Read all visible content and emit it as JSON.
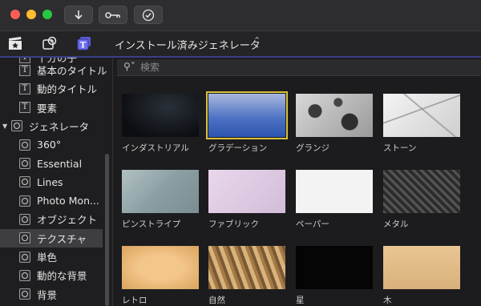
{
  "toolbar": {
    "traffic_colors": [
      "#ff5f57",
      "#febc2e",
      "#28c840"
    ],
    "import_icon": "download-arrow-icon",
    "key_icon": "key-icon",
    "check_icon": "checkmark-circle-icon"
  },
  "browser": {
    "popup_title": "インストール済みジェネレータ",
    "search_placeholder": "検索"
  },
  "sidebar": {
    "partial_item": "十分の子",
    "items": [
      {
        "label": "基本のタイトル",
        "icon": "title-t-icon"
      },
      {
        "label": "動的タイトル",
        "icon": "title-t-icon"
      },
      {
        "label": "要素",
        "icon": "title-t-icon"
      },
      {
        "label": "ジェネレータ",
        "icon": "generator-icon",
        "expanded": true
      },
      {
        "label": "360°",
        "icon": "generator-icon"
      },
      {
        "label": "Essential",
        "icon": "generator-icon"
      },
      {
        "label": "Lines",
        "icon": "generator-icon"
      },
      {
        "label": "Photo Mon...",
        "icon": "generator-icon"
      },
      {
        "label": "オブジェクト",
        "icon": "generator-icon"
      },
      {
        "label": "テクスチャ",
        "icon": "generator-icon",
        "selected": true
      },
      {
        "label": "単色",
        "icon": "generator-icon"
      },
      {
        "label": "動的な背景",
        "icon": "generator-icon"
      },
      {
        "label": "背景",
        "icon": "generator-icon"
      }
    ]
  },
  "thumbnails": [
    {
      "caption": "インダストリアル",
      "selected": false
    },
    {
      "caption": "グラデーション",
      "selected": true
    },
    {
      "caption": "グランジ",
      "selected": false
    },
    {
      "caption": "ストーン",
      "selected": false
    },
    {
      "caption": "ピンストライプ",
      "selected": false
    },
    {
      "caption": "ファブリック",
      "selected": false
    },
    {
      "caption": "ペーパー",
      "selected": false
    },
    {
      "caption": "メタル",
      "selected": false
    },
    {
      "caption": "レトロ",
      "selected": false
    },
    {
      "caption": "自然",
      "selected": false
    },
    {
      "caption": "星",
      "selected": false
    },
    {
      "caption": "木",
      "selected": false
    }
  ]
}
